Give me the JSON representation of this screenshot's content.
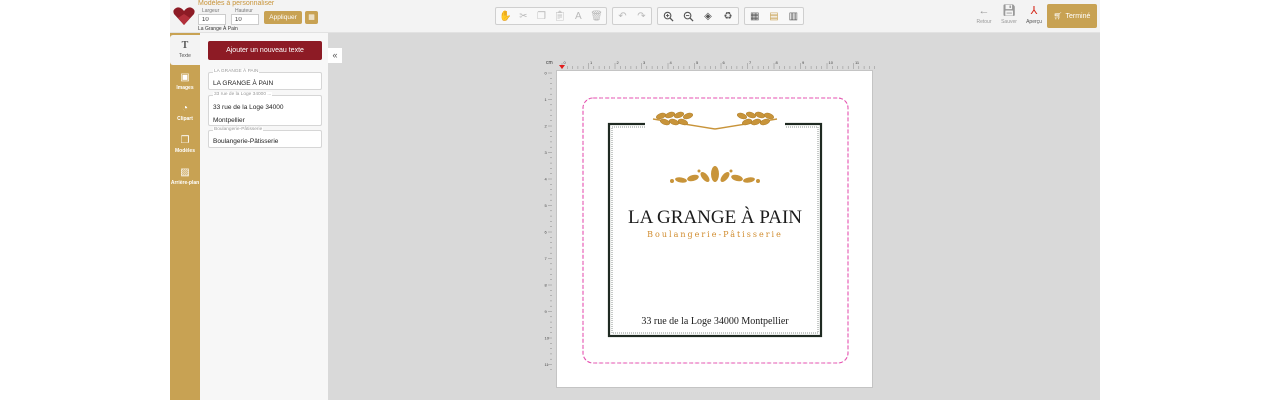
{
  "header": {
    "title": "Modèles à personnaliser",
    "template_name": "La Grange À Pain",
    "width_label": "Largeur",
    "width_value": "10",
    "height_label": "Hauteur",
    "height_value": "10",
    "apply_label": "Appliquer",
    "back_label": "Retour",
    "save_label": "Sauver",
    "preview_label": "Aperçu",
    "done_label": "Terminé"
  },
  "rail": {
    "items": [
      {
        "label": "Texte",
        "icon": "text-icon"
      },
      {
        "label": "Images",
        "icon": "image-icon"
      },
      {
        "label": "Clipart",
        "icon": "clipart-icon"
      },
      {
        "label": "Modèles",
        "icon": "templates-icon"
      },
      {
        "label": "Arrière-plan",
        "icon": "background-icon"
      }
    ]
  },
  "panel": {
    "add_text_label": "Ajouter un nouveau texte",
    "fields": [
      {
        "label": "LA GRANGE À PAIN",
        "value": "LA GRANGE À PAIN"
      },
      {
        "label": "33 rue de la Loge 34000 ...",
        "value": "33 rue de la Loge 34000\nMontpellier"
      },
      {
        "label": "Boulangerie-Pâtisserie",
        "value": "Boulangerie-Pâtisserie"
      }
    ]
  },
  "canvas": {
    "unit": "cm",
    "ruler_marks": [
      "0",
      "1",
      "2",
      "3",
      "4",
      "5",
      "6",
      "7",
      "8",
      "9",
      "10",
      "11"
    ],
    "design_title": "LA GRANGE À PAIN",
    "design_subtitle": "Boulangerie-Pâtisserie",
    "design_address": "33 rue de la Loge 34000 Montpellier"
  },
  "colors": {
    "gold": "#c8a253",
    "burgundy": "#8d1b25",
    "guide_pink": "#e94bb0",
    "frame_dark": "#1f2a22"
  }
}
